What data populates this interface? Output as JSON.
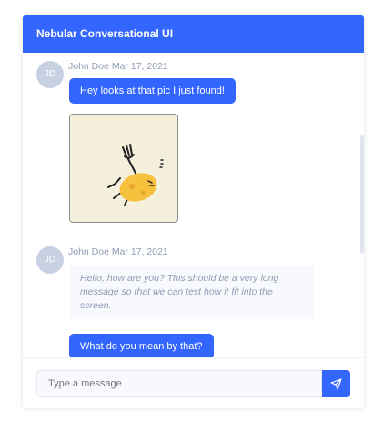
{
  "header": {
    "title": "Nebular Conversational UI"
  },
  "messages": [
    {
      "initials": "JD",
      "sender": "John Doe",
      "date": "Mar 17, 2021",
      "text": "Hey looks at that pic I just found!"
    },
    {
      "initials": "JD",
      "sender": "John Doe",
      "date": "Mar 17, 2021",
      "text": "Hello, how are you? This should be a very long message so that we can test how it fit into the screen."
    },
    {
      "text": "What do you mean by that?"
    }
  ],
  "composer": {
    "placeholder": "Type a message"
  },
  "colors": {
    "primary": "#3366ff",
    "muted": "#8f9bb3",
    "avatar": "#c8d1e1"
  },
  "icons": {
    "send": "send-icon"
  }
}
